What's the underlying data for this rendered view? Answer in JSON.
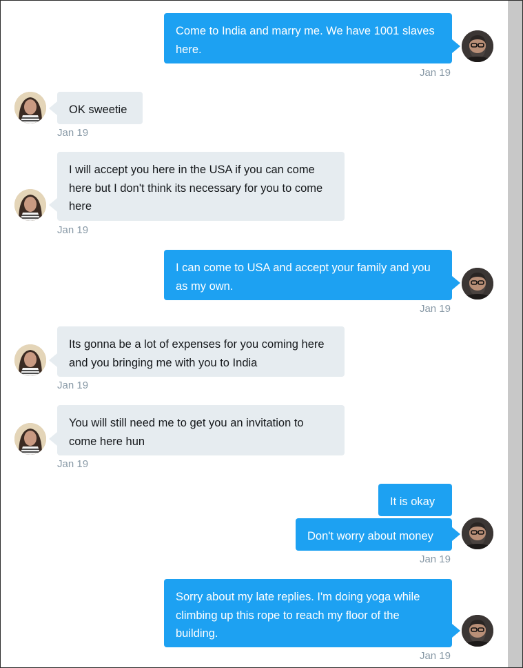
{
  "conversation": {
    "messages": [
      {
        "from": "me",
        "text": "Come to India and marry me. We have 1001 slaves here.",
        "time": "Jan 19"
      },
      {
        "from": "her",
        "text": "OK sweetie",
        "time": "Jan 19"
      },
      {
        "from": "her",
        "text": "I will accept you here in the USA if you can come here but I don't think its necessary for you to come here",
        "time": "Jan 19"
      },
      {
        "from": "me",
        "text": "I can come to USA and accept your family and you as my own.",
        "time": "Jan 19"
      },
      {
        "from": "her",
        "text": "Its gonna be a lot of expenses for you coming here and you bringing me with you to India",
        "time": "Jan 19"
      },
      {
        "from": "her",
        "text": "You will still need me to get you an invitation to come here hun",
        "time": "Jan 19"
      },
      {
        "from": "me",
        "text": "It is okay",
        "time": ""
      },
      {
        "from": "me",
        "text": "Don't worry about money",
        "time": "Jan 19"
      },
      {
        "from": "me",
        "text": "Sorry about my late replies. I'm doing yoga while climbing up this rope to reach my floor of the building.",
        "time": "Jan 19"
      }
    ]
  },
  "colors": {
    "sent_bubble": "#1da1f2",
    "received_bubble": "#e6ecf0",
    "timestamp": "#8899a6"
  }
}
